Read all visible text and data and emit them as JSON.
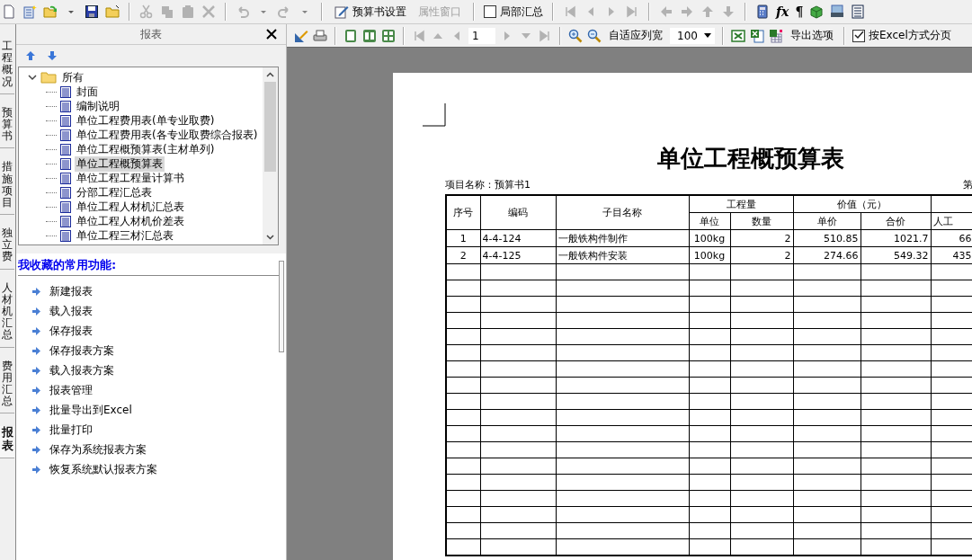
{
  "toolbar": {
    "items": [
      {
        "kind": "button",
        "label": "预算书设置",
        "disabled": false
      },
      {
        "kind": "button",
        "label": "属性窗口",
        "disabled": true
      },
      {
        "kind": "checkbox",
        "label": "局部汇总",
        "checked": false
      }
    ],
    "glyphs": [
      "fx",
      "¶"
    ]
  },
  "side_tabs": [
    {
      "label": "工程概况",
      "selected": false
    },
    {
      "label": "预算书",
      "selected": false
    },
    {
      "label": "措施项目",
      "selected": false
    },
    {
      "label": "独立费",
      "selected": false
    },
    {
      "label": "人材机汇总",
      "selected": false
    },
    {
      "label": "费用汇总",
      "selected": false
    },
    {
      "label": "报表",
      "selected": true
    }
  ],
  "report_panel": {
    "title": "报表",
    "tree": {
      "label": "所有",
      "expanded": true,
      "children": [
        {
          "label": "封面",
          "selected": false
        },
        {
          "label": "编制说明",
          "selected": false
        },
        {
          "label": "单位工程费用表(单专业取费)",
          "selected": false
        },
        {
          "label": "单位工程费用表(各专业取费综合报表)",
          "selected": false
        },
        {
          "label": "单位工程概预算表(主材单列)",
          "selected": false
        },
        {
          "label": "单位工程概预算表",
          "selected": true
        },
        {
          "label": "单位工程工程量计算书",
          "selected": false
        },
        {
          "label": "分部工程汇总表",
          "selected": false
        },
        {
          "label": "单位工程人材机汇总表",
          "selected": false
        },
        {
          "label": "单位工程人材机价差表",
          "selected": false
        },
        {
          "label": "单位工程三材汇总表",
          "selected": false
        }
      ]
    }
  },
  "favorites": {
    "heading": "我收藏的常用功能:",
    "items": [
      "新建报表",
      "载入报表",
      "保存报表",
      "保存报表方案",
      "载入报表方案",
      "报表管理",
      "批量导出到Excel",
      "批量打印",
      "保存为系统报表方案",
      "恢复系统默认报表方案"
    ]
  },
  "preview_toolbar": {
    "page": "1",
    "fit_label": "自适应列宽",
    "zoom": "100",
    "export_label": "导出选项",
    "excel_paging": {
      "label": "按Excel方式分页",
      "checked": true
    }
  },
  "document": {
    "title": "单位工程概预算表",
    "project": "项目名称：预算书1",
    "page_label": "第",
    "header": {
      "seq": "序号",
      "code": "编码",
      "name": "子目名称",
      "quantity": {
        "label": "工程量",
        "sub": [
          "单位",
          "数量"
        ]
      },
      "value": {
        "label": "价值（元）",
        "sub": [
          "单价",
          "合价"
        ]
      },
      "column_8": "人工"
    },
    "rows": [
      {
        "cells": [
          "1",
          "4-4-124",
          "一般铁构件制作",
          "100kg",
          "2",
          "510.85",
          "1021.7",
          "66"
        ]
      },
      {
        "cells": [
          "2",
          "4-4-125",
          "一般铁构件安装",
          "100kg",
          "2",
          "274.66",
          "549.32",
          "435"
        ]
      }
    ]
  }
}
